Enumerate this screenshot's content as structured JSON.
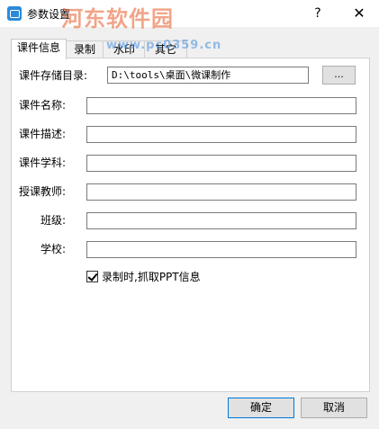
{
  "window": {
    "title": "参数设置",
    "help": "?",
    "close": "✕"
  },
  "watermark": {
    "text": "河东软件园",
    "url": "www.pc0359.cn"
  },
  "tabs": [
    {
      "label": "课件信息",
      "active": true
    },
    {
      "label": "录制",
      "active": false
    },
    {
      "label": "水印",
      "active": false
    },
    {
      "label": "其它",
      "active": false
    }
  ],
  "form": {
    "storage_dir": {
      "label": "课件存储目录:",
      "value": "D:\\tools\\桌面\\微课制作"
    },
    "browse_label": "...",
    "name": {
      "label": "课件名称:",
      "value": ""
    },
    "description": {
      "label": "课件描述:",
      "value": ""
    },
    "subject": {
      "label": "课件学科:",
      "value": ""
    },
    "teacher": {
      "label": "授课教师:",
      "value": ""
    },
    "class": {
      "label": "班级:",
      "value": ""
    },
    "school": {
      "label": "学校:",
      "value": ""
    },
    "ppt_capture": {
      "label": "录制时,抓取PPT信息",
      "checked": true
    }
  },
  "footer": {
    "ok": "确定",
    "cancel": "取消"
  }
}
